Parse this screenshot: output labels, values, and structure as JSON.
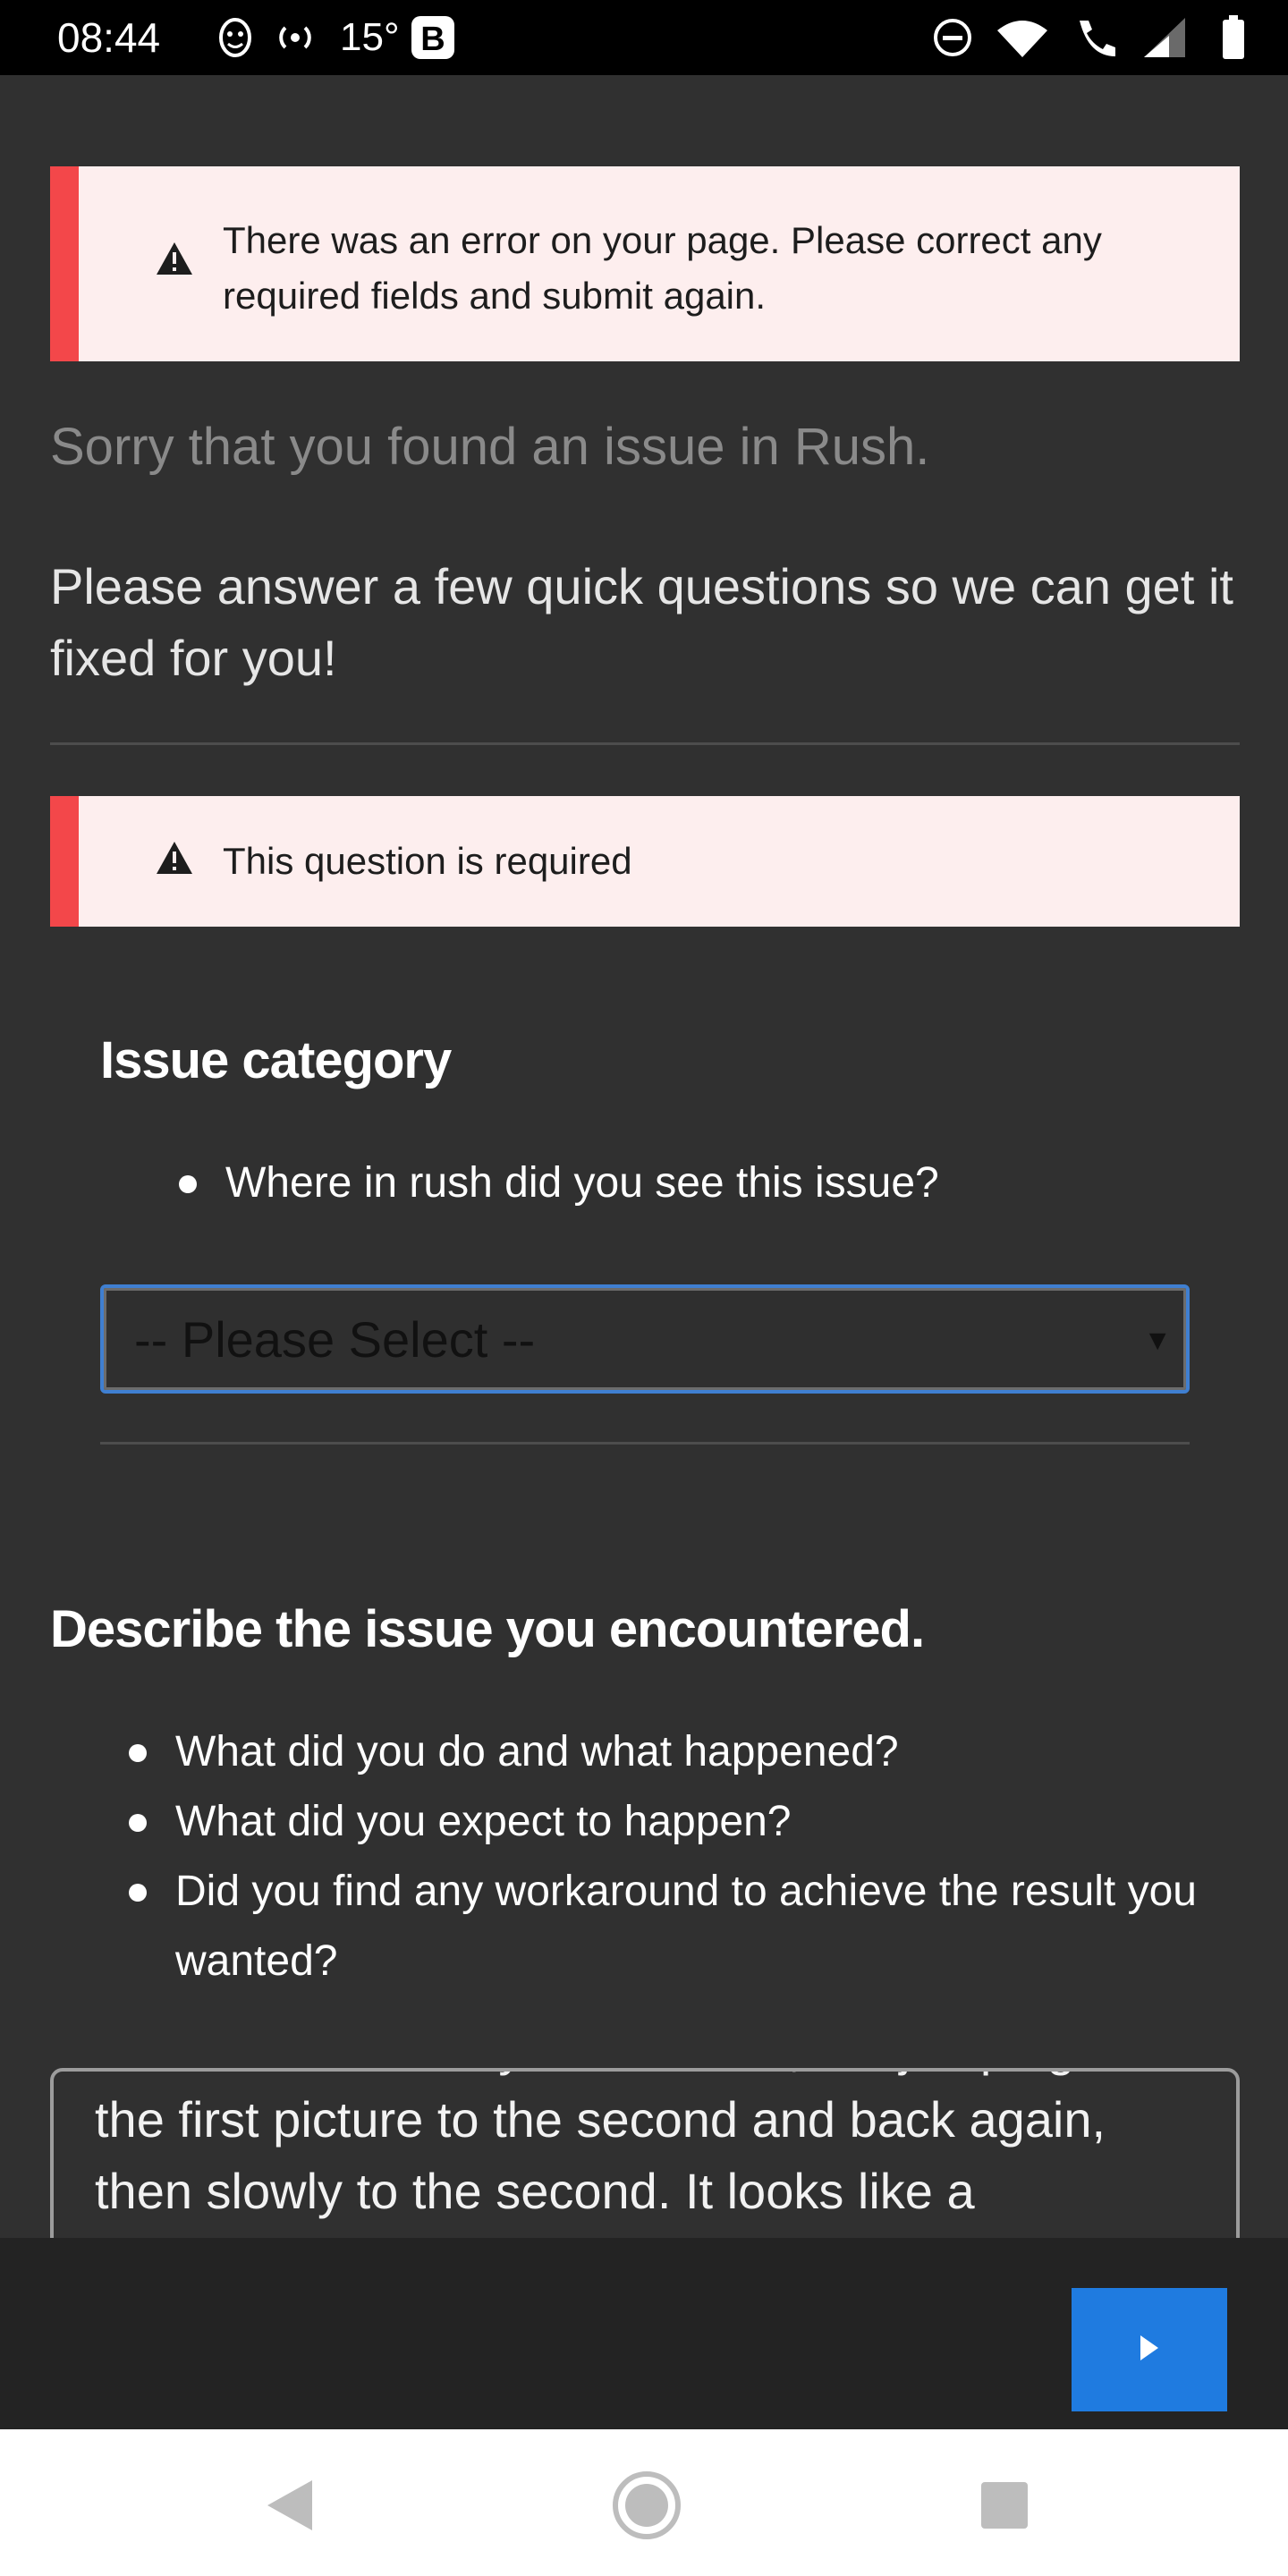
{
  "status_bar": {
    "time": "08:44",
    "temperature": "15°",
    "left_icons": [
      "smiley-face-notification-icon",
      "hotspot-icon",
      "temperature",
      "b-app-icon"
    ],
    "right_icons": [
      "do-not-disturb-icon",
      "wifi-icon",
      "wifi-calling-icon",
      "signal-icon",
      "battery-icon"
    ]
  },
  "alerts": {
    "page_error": "There was an error on your page. Please correct any required fields and submit again.",
    "question_required": "This question is required"
  },
  "intro": {
    "sorry_text": "Sorry that you found an issue in Rush.",
    "instructions": "Please answer a few quick questions so we can get it fixed for you!"
  },
  "question1": {
    "title": "Issue category",
    "bullets": [
      "Where in rush did you see this issue?"
    ],
    "select_value": "-- Please Select --"
  },
  "question2": {
    "title": "Describe the issue you encountered.",
    "bullets": [
      "What did you do and what happened?",
      "What did you expect to happen?",
      "Did you find any workaround to achieve the result you wanted?"
    ],
    "textarea_value": "are as follows: they are not soft, but jumping from the first picture to the second and back again, then slowly to the second. It looks like a"
  },
  "footer": {
    "next_button_icon": "play-right-arrow-icon"
  },
  "colors": {
    "page_bg": "#303030",
    "alert_bg": "#fdeeee",
    "alert_accent": "#f3474a",
    "select_border": "#3f7fd1",
    "next_button": "#1f7be0"
  }
}
